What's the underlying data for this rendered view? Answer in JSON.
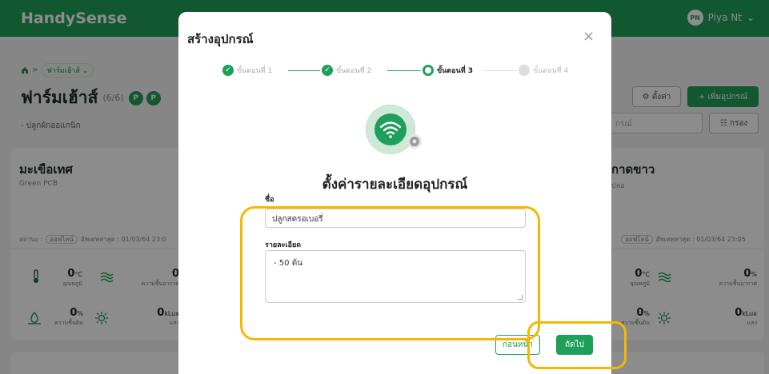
{
  "app": {
    "name": "HandySense"
  },
  "user": {
    "initials": "PN",
    "name": "Piya Nt",
    "caret": "⌄"
  },
  "breadcrumb": {
    "home_icon": "home-icon",
    "separator": ">",
    "current": "ฟาร์มเฮ้าส์ ⌄"
  },
  "farm": {
    "title": "ฟาร์มเฮ้าส์",
    "count": "(6/6)",
    "badges": [
      "P",
      "P"
    ],
    "subtitle": "- ปลูกผักออแกนิก"
  },
  "toolbar": {
    "settings_label": "⚙ ตั้งค่า",
    "add_label": "+ เพิ่มอุปกรณ์",
    "search_placeholder": "กรณ์",
    "filter_label": "☷ กรอง"
  },
  "cards": [
    {
      "title": "มะเขือเทศ",
      "subtitle": "Green PCB",
      "status_label": "สถานะ :",
      "status_value": "ออฟไลน์",
      "updated": "อัพเดทล่าสุด : 01/03/64 23:0",
      "metrics": [
        {
          "value": "0",
          "unit": "°C",
          "label": "อุณหภูมิ"
        },
        {
          "value": "0",
          "unit": "",
          "label": "ความชื้นอากาศ"
        },
        {
          "value": "0",
          "unit": "%",
          "label": "ความชื้นดิน"
        },
        {
          "value": "0",
          "unit": "kLux",
          "label": "แสง"
        }
      ]
    },
    {
      "title": "กาดขาว",
      "subtitle": "ปลอ",
      "status_value": "ออฟไลน์",
      "updated": "อัพเดทล่าสุด : 01/03/64 23:05",
      "metrics": [
        {
          "value": "0",
          "unit": "°C",
          "label": "อุณหภูมิ"
        },
        {
          "value": "0",
          "unit": "%",
          "label": "ความชื้นอากาศ"
        },
        {
          "value": "0",
          "unit": "%",
          "label": "ความชื้นดิน"
        },
        {
          "value": "0",
          "unit": "kLux",
          "label": "แสง"
        }
      ]
    }
  ],
  "modal": {
    "title": "สร้างอุปกรณ์",
    "close_icon": "×",
    "steps": [
      {
        "label": "ขั้นตอนที่ 1",
        "state": "done"
      },
      {
        "label": "ขั้นตอนที่ 2",
        "state": "done"
      },
      {
        "label": "ขั้นตอนที่ 3",
        "state": "active"
      },
      {
        "label": "ขั้นตอนที่ 4",
        "state": "todo"
      }
    ],
    "heading": "ตั้งค่ารายละเอียดอุปกรณ์",
    "name_label": "ชื่อ",
    "name_value": "ปลูกสตรอเบอรี่",
    "detail_label": "รายละเอียด",
    "detail_value": "- 50 ต้น",
    "back_label": "ก่อนหน้า",
    "next_label": "ถัดไป"
  },
  "colors": {
    "brand": "#1fa05a",
    "highlight": "#f5b800"
  }
}
